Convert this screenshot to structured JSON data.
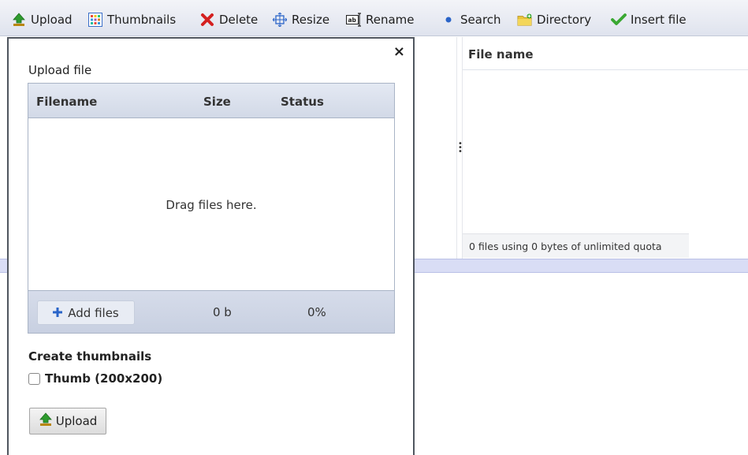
{
  "toolbar": {
    "upload": "Upload",
    "thumbnails": "Thumbnails",
    "delete": "Delete",
    "resize": "Resize",
    "rename": "Rename",
    "search": "Search",
    "directory": "Directory",
    "insert": "Insert file"
  },
  "file_list": {
    "column": "File name",
    "status": "0 files using 0 bytes of unlimited quota"
  },
  "dialog": {
    "close": "×",
    "title": "Upload file",
    "columns": {
      "filename": "Filename",
      "size": "Size",
      "status": "Status"
    },
    "drop_text": "Drag files here.",
    "add_files": "Add files",
    "total_size": "0 b",
    "total_percent": "0%",
    "thumbnails_heading": "Create thumbnails",
    "thumb_option": "Thumb (200x200)",
    "thumb_checked": false,
    "upload_button": "Upload"
  },
  "colors": {
    "upload_green": "#2e9b2e",
    "delete_red": "#d42020",
    "insert_green": "#3aa832",
    "accent_blue": "#2a64c8",
    "folder_yellow": "#e8c339"
  },
  "icons": {
    "upload": "upload-arrow-icon",
    "thumbnails": "grid-icon",
    "delete": "red-x-icon",
    "resize": "resize-icon",
    "rename": "rename-icon",
    "search": "dot-icon",
    "directory": "folder-icon",
    "insert": "checkmark-icon"
  }
}
